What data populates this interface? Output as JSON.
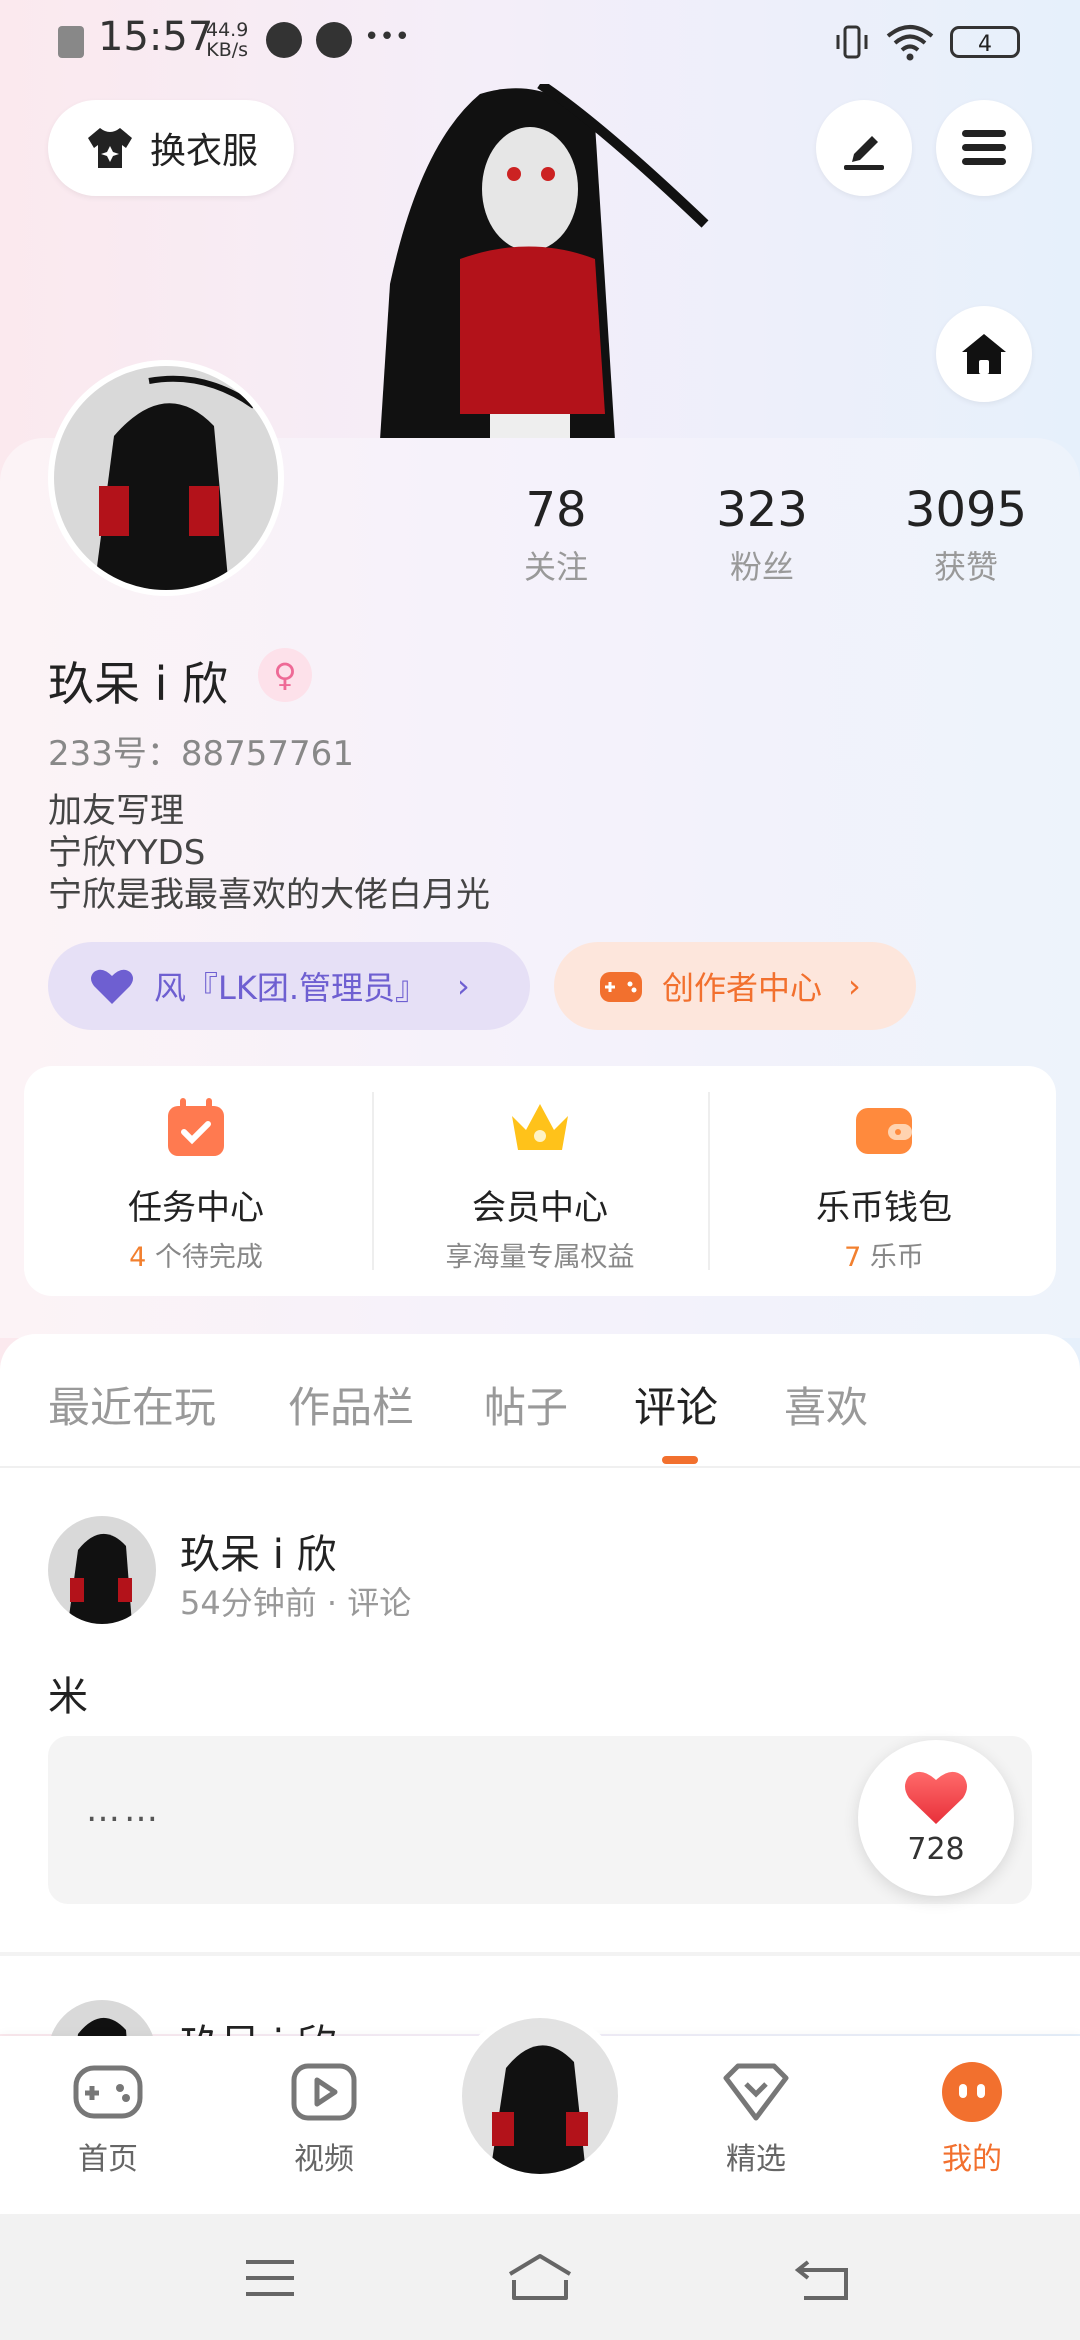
{
  "status_bar": {
    "time": "15:57",
    "speed_value": "44.9",
    "speed_unit": "KB/s",
    "more": "•••",
    "battery": "4"
  },
  "top": {
    "outfit_label": "换衣服"
  },
  "profile": {
    "stats": [
      {
        "num": "78",
        "label": "关注"
      },
      {
        "num": "323",
        "label": "粉丝"
      },
      {
        "num": "3095",
        "label": "获赞"
      }
    ],
    "name": "玖呆 i 欣",
    "gender_symbol": "♀",
    "uid": "233号：88757761",
    "bio": [
      "加友写理",
      "宁欣YYDS",
      "宁欣是我最喜欢的大佬白月光"
    ],
    "tag_group": "风『LK团.管理员』",
    "tag_creator": "创作者中心"
  },
  "features": [
    {
      "title": "任务中心",
      "num": "4",
      "sub": " 个待完成"
    },
    {
      "title": "会员中心",
      "num": "",
      "sub": "享海量专属权益"
    },
    {
      "title": "乐币钱包",
      "num": "7",
      "sub": " 乐币"
    }
  ],
  "tabs": [
    "最近在玩",
    "作品栏",
    "帖子",
    "评论",
    "喜欢"
  ],
  "active_tab": "评论",
  "post": {
    "name": "玖呆 i 欣",
    "meta": "54分钟前 · 评论",
    "text": "米",
    "quote": "……",
    "likes": "728"
  },
  "post2": {
    "name": "玖呆 i 欣"
  },
  "bottom_nav": [
    "首页",
    "视频",
    "精选",
    "我的"
  ],
  "colors": {
    "accent": "#f2702e",
    "purple": "#6e5fd1"
  }
}
